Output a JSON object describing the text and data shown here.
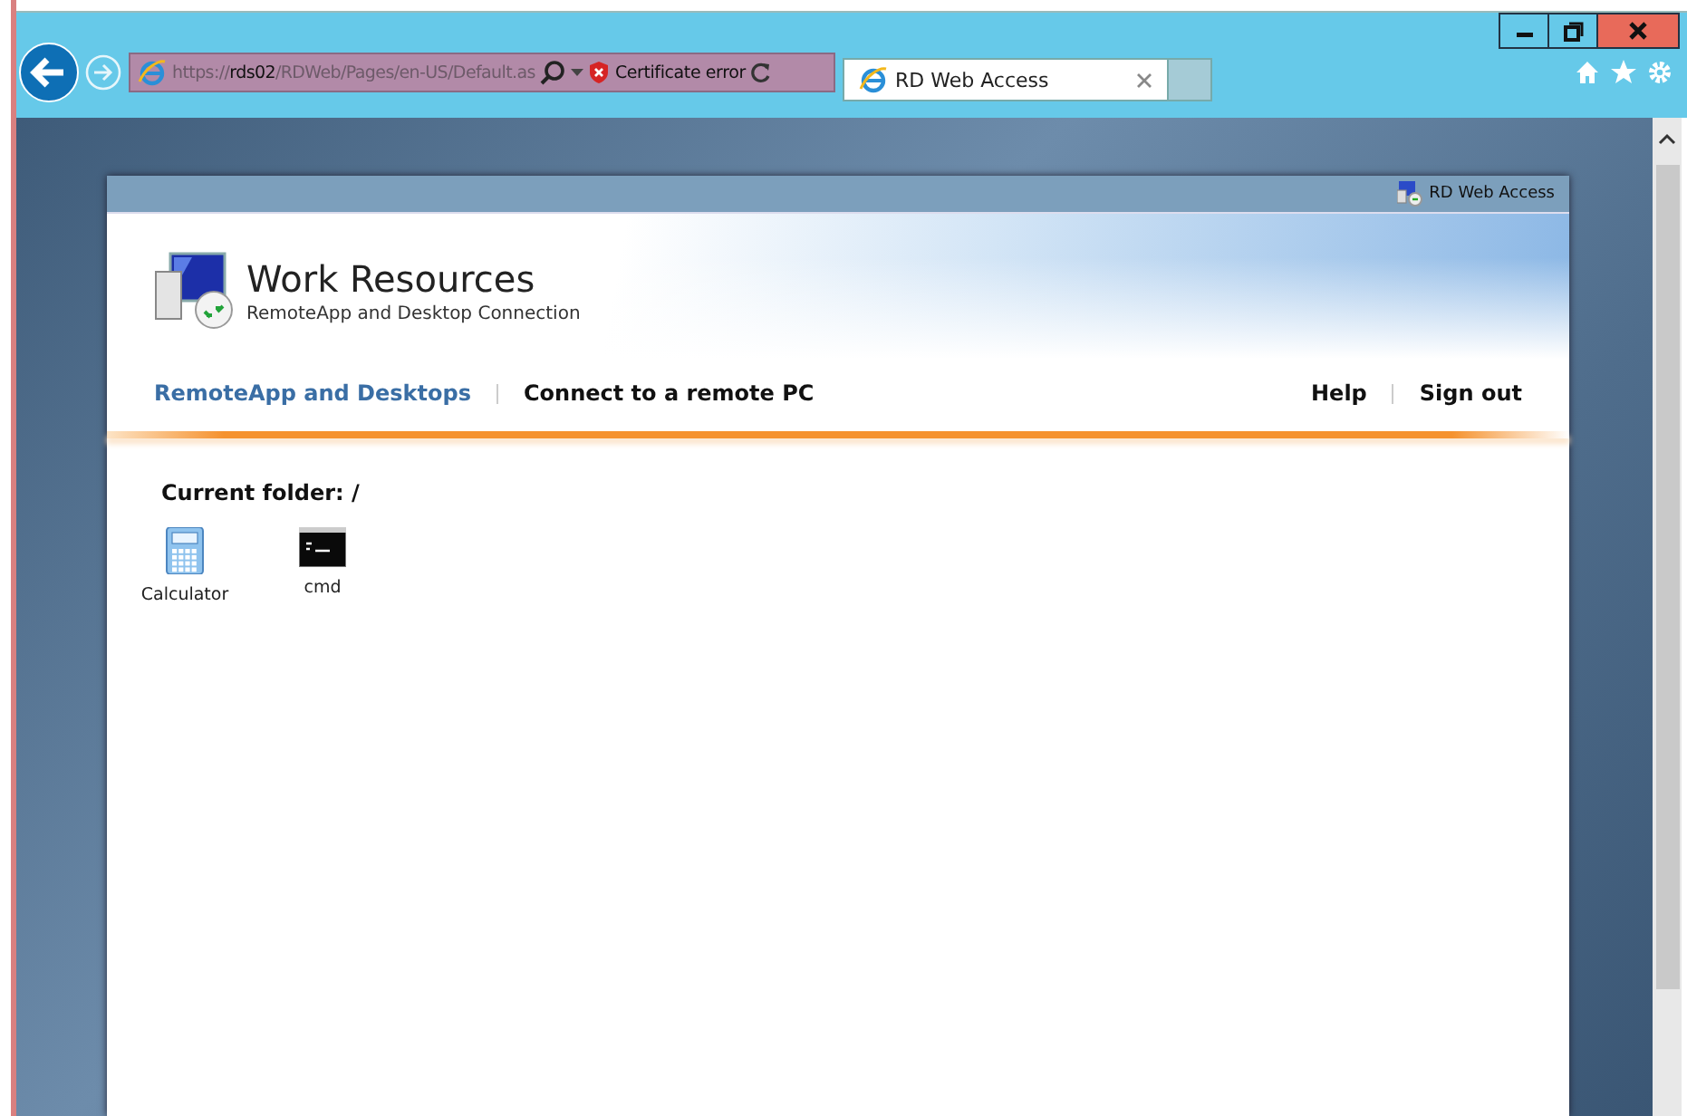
{
  "browser": {
    "address": {
      "scheme": "https://",
      "host": "rds02",
      "path": "/RDWeb/Pages/en-US/Default.as"
    },
    "certificate": "Certificate error",
    "tabs": [
      {
        "label": "RD Web Access",
        "selected": true
      }
    ]
  },
  "page": {
    "header_link": "RD Web Access",
    "title": "Work Resources",
    "subtitle": "RemoteApp and Desktop Connection",
    "nav": [
      {
        "label": "RemoteApp and Desktops",
        "selected": true
      },
      {
        "label": "Connect to a remote PC",
        "selected": false
      }
    ],
    "nav_right": [
      "Help",
      "Sign out"
    ],
    "folder": "Current folder: /",
    "apps": [
      {
        "label": "Calculator",
        "kind": "calculator"
      },
      {
        "label": "cmd",
        "kind": "console"
      }
    ]
  }
}
